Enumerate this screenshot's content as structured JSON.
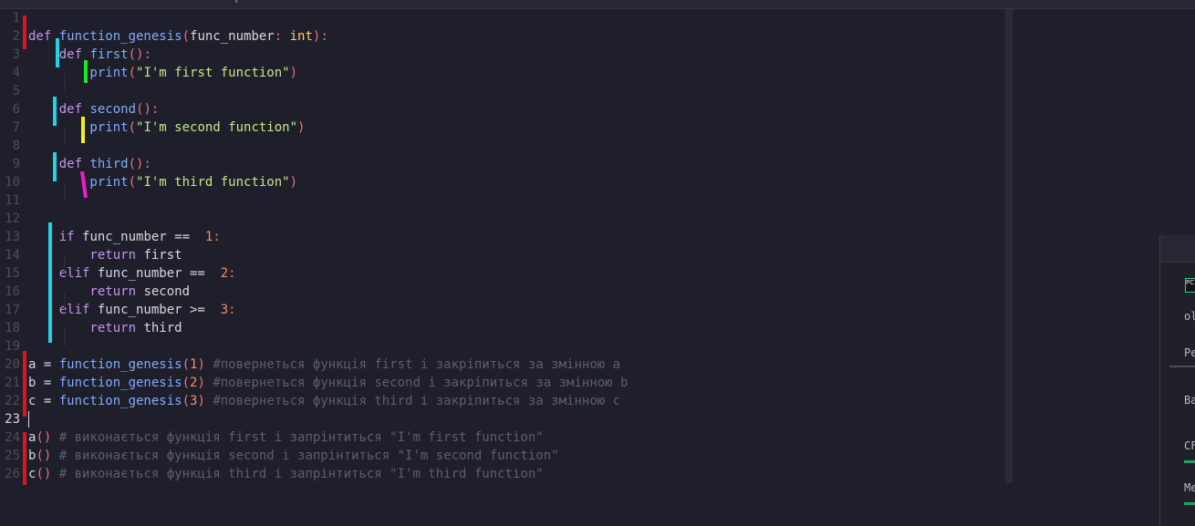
{
  "editor": {
    "lines": [
      {
        "n": "1",
        "tokens": []
      },
      {
        "n": "2",
        "tokens": [
          {
            "c": "kw",
            "t": "def "
          },
          {
            "c": "fn",
            "t": "function_genesis"
          },
          {
            "c": "pn",
            "t": "("
          },
          {
            "c": "id",
            "t": "func_number"
          },
          {
            "c": "pn",
            "t": ": "
          },
          {
            "c": "ty",
            "t": "int"
          },
          {
            "c": "pn",
            "t": "):"
          }
        ]
      },
      {
        "n": "3",
        "tokens": [
          {
            "c": "kw",
            "t": "    def "
          },
          {
            "c": "fn",
            "t": "first"
          },
          {
            "c": "pn",
            "t": "():"
          }
        ]
      },
      {
        "n": "4",
        "tokens": [
          {
            "c": "fn",
            "t": "        print"
          },
          {
            "c": "pn",
            "t": "("
          },
          {
            "c": "str",
            "t": "\"I'm first function\""
          },
          {
            "c": "pn",
            "t": ")"
          }
        ]
      },
      {
        "n": "5",
        "tokens": []
      },
      {
        "n": "6",
        "tokens": [
          {
            "c": "kw",
            "t": "    def "
          },
          {
            "c": "fn",
            "t": "second"
          },
          {
            "c": "pn",
            "t": "():"
          }
        ]
      },
      {
        "n": "7",
        "tokens": [
          {
            "c": "fn",
            "t": "        print"
          },
          {
            "c": "pn",
            "t": "("
          },
          {
            "c": "str",
            "t": "\"I'm second function\""
          },
          {
            "c": "pn",
            "t": ")"
          }
        ]
      },
      {
        "n": "8",
        "tokens": []
      },
      {
        "n": "9",
        "tokens": [
          {
            "c": "kw",
            "t": "    def "
          },
          {
            "c": "fn",
            "t": "third"
          },
          {
            "c": "pn",
            "t": "():"
          }
        ]
      },
      {
        "n": "10",
        "tokens": [
          {
            "c": "fn",
            "t": "        print"
          },
          {
            "c": "pn",
            "t": "("
          },
          {
            "c": "str",
            "t": "\"I'm third function\""
          },
          {
            "c": "pn",
            "t": ")"
          }
        ]
      },
      {
        "n": "11",
        "tokens": []
      },
      {
        "n": "12",
        "tokens": []
      },
      {
        "n": "13",
        "tokens": [
          {
            "c": "kw",
            "t": "    if "
          },
          {
            "c": "id",
            "t": "func_number == "
          },
          {
            "c": "num",
            "t": " 1"
          },
          {
            "c": "pn",
            "t": ":"
          }
        ]
      },
      {
        "n": "14",
        "tokens": [
          {
            "c": "kw",
            "t": "        return "
          },
          {
            "c": "id",
            "t": "first"
          }
        ]
      },
      {
        "n": "15",
        "tokens": [
          {
            "c": "kw",
            "t": "    elif "
          },
          {
            "c": "id",
            "t": "func_number == "
          },
          {
            "c": "num",
            "t": " 2"
          },
          {
            "c": "pn",
            "t": ":"
          }
        ]
      },
      {
        "n": "16",
        "tokens": [
          {
            "c": "kw",
            "t": "        return "
          },
          {
            "c": "id",
            "t": "second"
          }
        ]
      },
      {
        "n": "17",
        "tokens": [
          {
            "c": "kw",
            "t": "    elif "
          },
          {
            "c": "id",
            "t": "func_number >= "
          },
          {
            "c": "num",
            "t": " 3"
          },
          {
            "c": "pn",
            "t": ":"
          }
        ]
      },
      {
        "n": "18",
        "tokens": [
          {
            "c": "kw",
            "t": "        return "
          },
          {
            "c": "id",
            "t": "third"
          }
        ]
      },
      {
        "n": "19",
        "tokens": []
      },
      {
        "n": "20",
        "tokens": [
          {
            "c": "id",
            "t": "a = "
          },
          {
            "c": "fn",
            "t": "function_genesis"
          },
          {
            "c": "pn",
            "t": "("
          },
          {
            "c": "num",
            "t": "1"
          },
          {
            "c": "pn",
            "t": ")"
          },
          {
            "c": "cm",
            "t": " #повернеться функція first і закріпиться за змінною a"
          }
        ]
      },
      {
        "n": "21",
        "tokens": [
          {
            "c": "id",
            "t": "b = "
          },
          {
            "c": "fn",
            "t": "function_genesis"
          },
          {
            "c": "pn",
            "t": "("
          },
          {
            "c": "num",
            "t": "2"
          },
          {
            "c": "pn",
            "t": ")"
          },
          {
            "c": "cm",
            "t": " #повернеться функція second і закріпиться за змінною b"
          }
        ]
      },
      {
        "n": "22",
        "tokens": [
          {
            "c": "id",
            "t": "c = "
          },
          {
            "c": "fn",
            "t": "function_genesis"
          },
          {
            "c": "pn",
            "t": "("
          },
          {
            "c": "num",
            "t": "3"
          },
          {
            "c": "pn",
            "t": ")"
          },
          {
            "c": "cm",
            "t": " #повернеться функція third і закріпиться за змінною c"
          }
        ]
      },
      {
        "n": "23",
        "tokens": []
      },
      {
        "n": "24",
        "tokens": [
          {
            "c": "id",
            "t": "a"
          },
          {
            "c": "pn",
            "t": "()"
          },
          {
            "c": "cm",
            "t": " # виконається функція first і запрінтиться \"I'm first function\""
          }
        ]
      },
      {
        "n": "25",
        "tokens": [
          {
            "c": "id",
            "t": "b"
          },
          {
            "c": "pn",
            "t": "()"
          },
          {
            "c": "cm",
            "t": " # виконається функція second і запрінтиться \"I'm second function\""
          }
        ]
      },
      {
        "n": "26",
        "tokens": [
          {
            "c": "id",
            "t": "c"
          },
          {
            "c": "pn",
            "t": "()"
          },
          {
            "c": "cm",
            "t": " # виконається функція third і запрінтиться \"I'm third function\""
          }
        ]
      }
    ],
    "current_line": "23"
  },
  "side_panel": {
    "icon_label": "PC",
    "rows": [
      "ol",
      "Pe",
      "Ba",
      "CF",
      "Me"
    ]
  },
  "colors": {
    "background": "#1e1f2b",
    "keyword": "#c792ea",
    "function": "#82aaff",
    "string": "#c3e88d",
    "number": "#f78c6c",
    "comment": "#5c5e6e",
    "bracket_red": "#e0141e",
    "bracket_cyan": "#22d3e6",
    "bracket_green": "#1ee82a",
    "bracket_yellow": "#f2f21e",
    "bracket_magenta": "#f01ec8"
  }
}
